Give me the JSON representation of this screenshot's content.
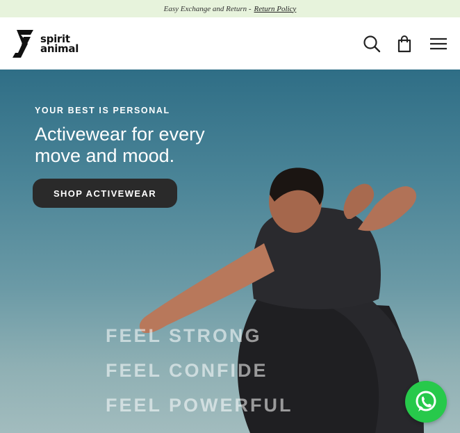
{
  "announcement": {
    "text": "Easy Exchange and Return -",
    "link": "Return Policy"
  },
  "header": {
    "logo_line1": "spirit",
    "logo_line2": "animal",
    "icons": [
      "search-icon",
      "cart-icon",
      "menu-icon"
    ]
  },
  "hero": {
    "eyebrow": "YOUR BEST IS PERSONAL",
    "headline_line1": "Activewear for every",
    "headline_line2": "move and mood.",
    "cta": "SHOP ACTIVEWEAR",
    "feel_lines": [
      "FEEL STRONG",
      "FEEL CONFIDE",
      "FEEL POWERFUL"
    ]
  },
  "colors": {
    "announcement_bg": "#e7f3dc",
    "cta_bg": "#2a2a2a",
    "whatsapp": "#27c94b"
  }
}
